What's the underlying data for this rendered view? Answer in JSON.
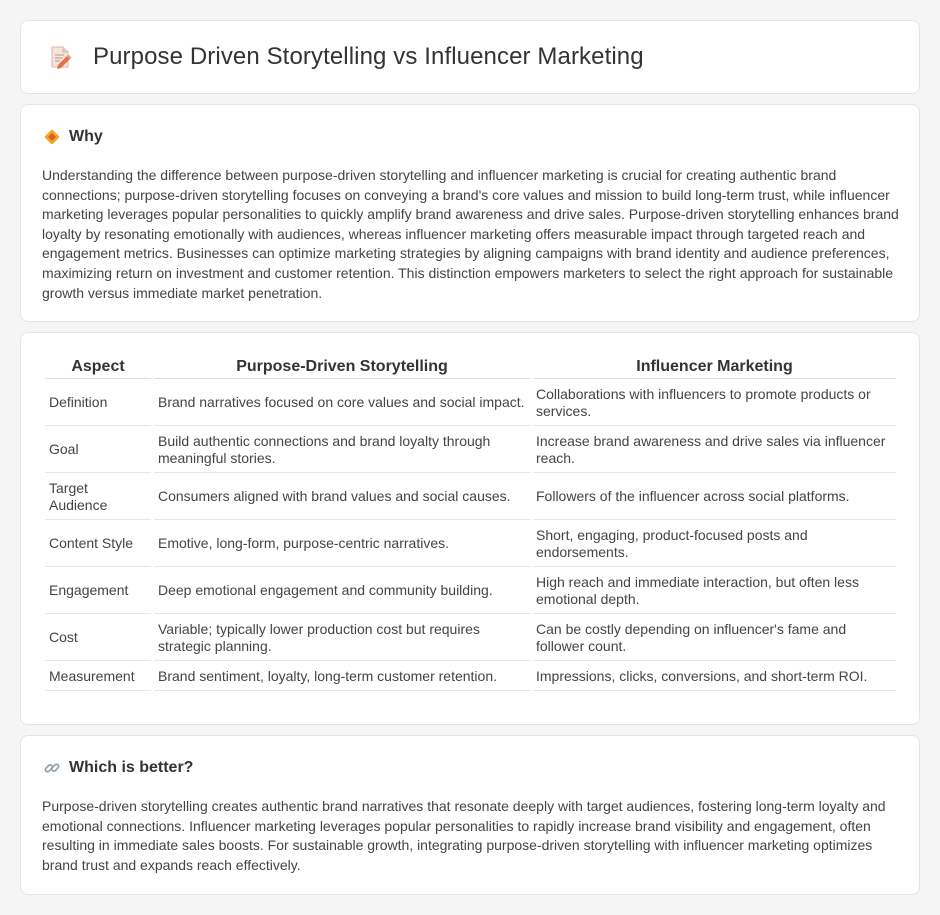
{
  "header": {
    "title": "Purpose Driven Storytelling vs Influencer Marketing",
    "icon": "document-pen-icon"
  },
  "why": {
    "title": "Why",
    "icon": "diamond-sign-icon",
    "text": "Understanding the difference between purpose-driven storytelling and influencer marketing is crucial for creating authentic brand connections; purpose-driven storytelling focuses on conveying a brand's core values and mission to build long-term trust, while influencer marketing leverages popular personalities to quickly amplify brand awareness and drive sales. Purpose-driven storytelling enhances brand loyalty by resonating emotionally with audiences, whereas influencer marketing offers measurable impact through targeted reach and engagement metrics. Businesses can optimize marketing strategies by aligning campaigns with brand identity and audience preferences, maximizing return on investment and customer retention. This distinction empowers marketers to select the right approach for sustainable growth versus immediate market penetration."
  },
  "table": {
    "headers": [
      "Aspect",
      "Purpose-Driven Storytelling",
      "Influencer Marketing"
    ],
    "rows": [
      [
        "Definition",
        "Brand narratives focused on core values and social impact.",
        "Collaborations with influencers to promote products or services."
      ],
      [
        "Goal",
        "Build authentic connections and brand loyalty through meaningful stories.",
        "Increase brand awareness and drive sales via influencer reach."
      ],
      [
        "Target Audience",
        "Consumers aligned with brand values and social causes.",
        "Followers of the influencer across social platforms."
      ],
      [
        "Content Style",
        "Emotive, long-form, purpose-centric narratives.",
        "Short, engaging, product-focused posts and endorsements."
      ],
      [
        "Engagement",
        "Deep emotional engagement and community building.",
        "High reach and immediate interaction, but often less emotional depth."
      ],
      [
        "Cost",
        "Variable; typically lower production cost but requires strategic planning.",
        "Can be costly depending on influencer's fame and follower count."
      ],
      [
        "Measurement",
        "Brand sentiment, loyalty, long-term customer retention.",
        "Impressions, clicks, conversions, and short-term ROI."
      ]
    ]
  },
  "better": {
    "title": "Which is better?",
    "icon": "link-icon",
    "text": "Purpose-driven storytelling creates authentic brand narratives that resonate deeply with target audiences, fostering long-term loyalty and emotional connections. Influencer marketing leverages popular personalities to rapidly increase brand visibility and engagement, often resulting in immediate sales boosts. For sustainable growth, integrating purpose-driven storytelling with influencer marketing optimizes brand trust and expands reach effectively."
  }
}
